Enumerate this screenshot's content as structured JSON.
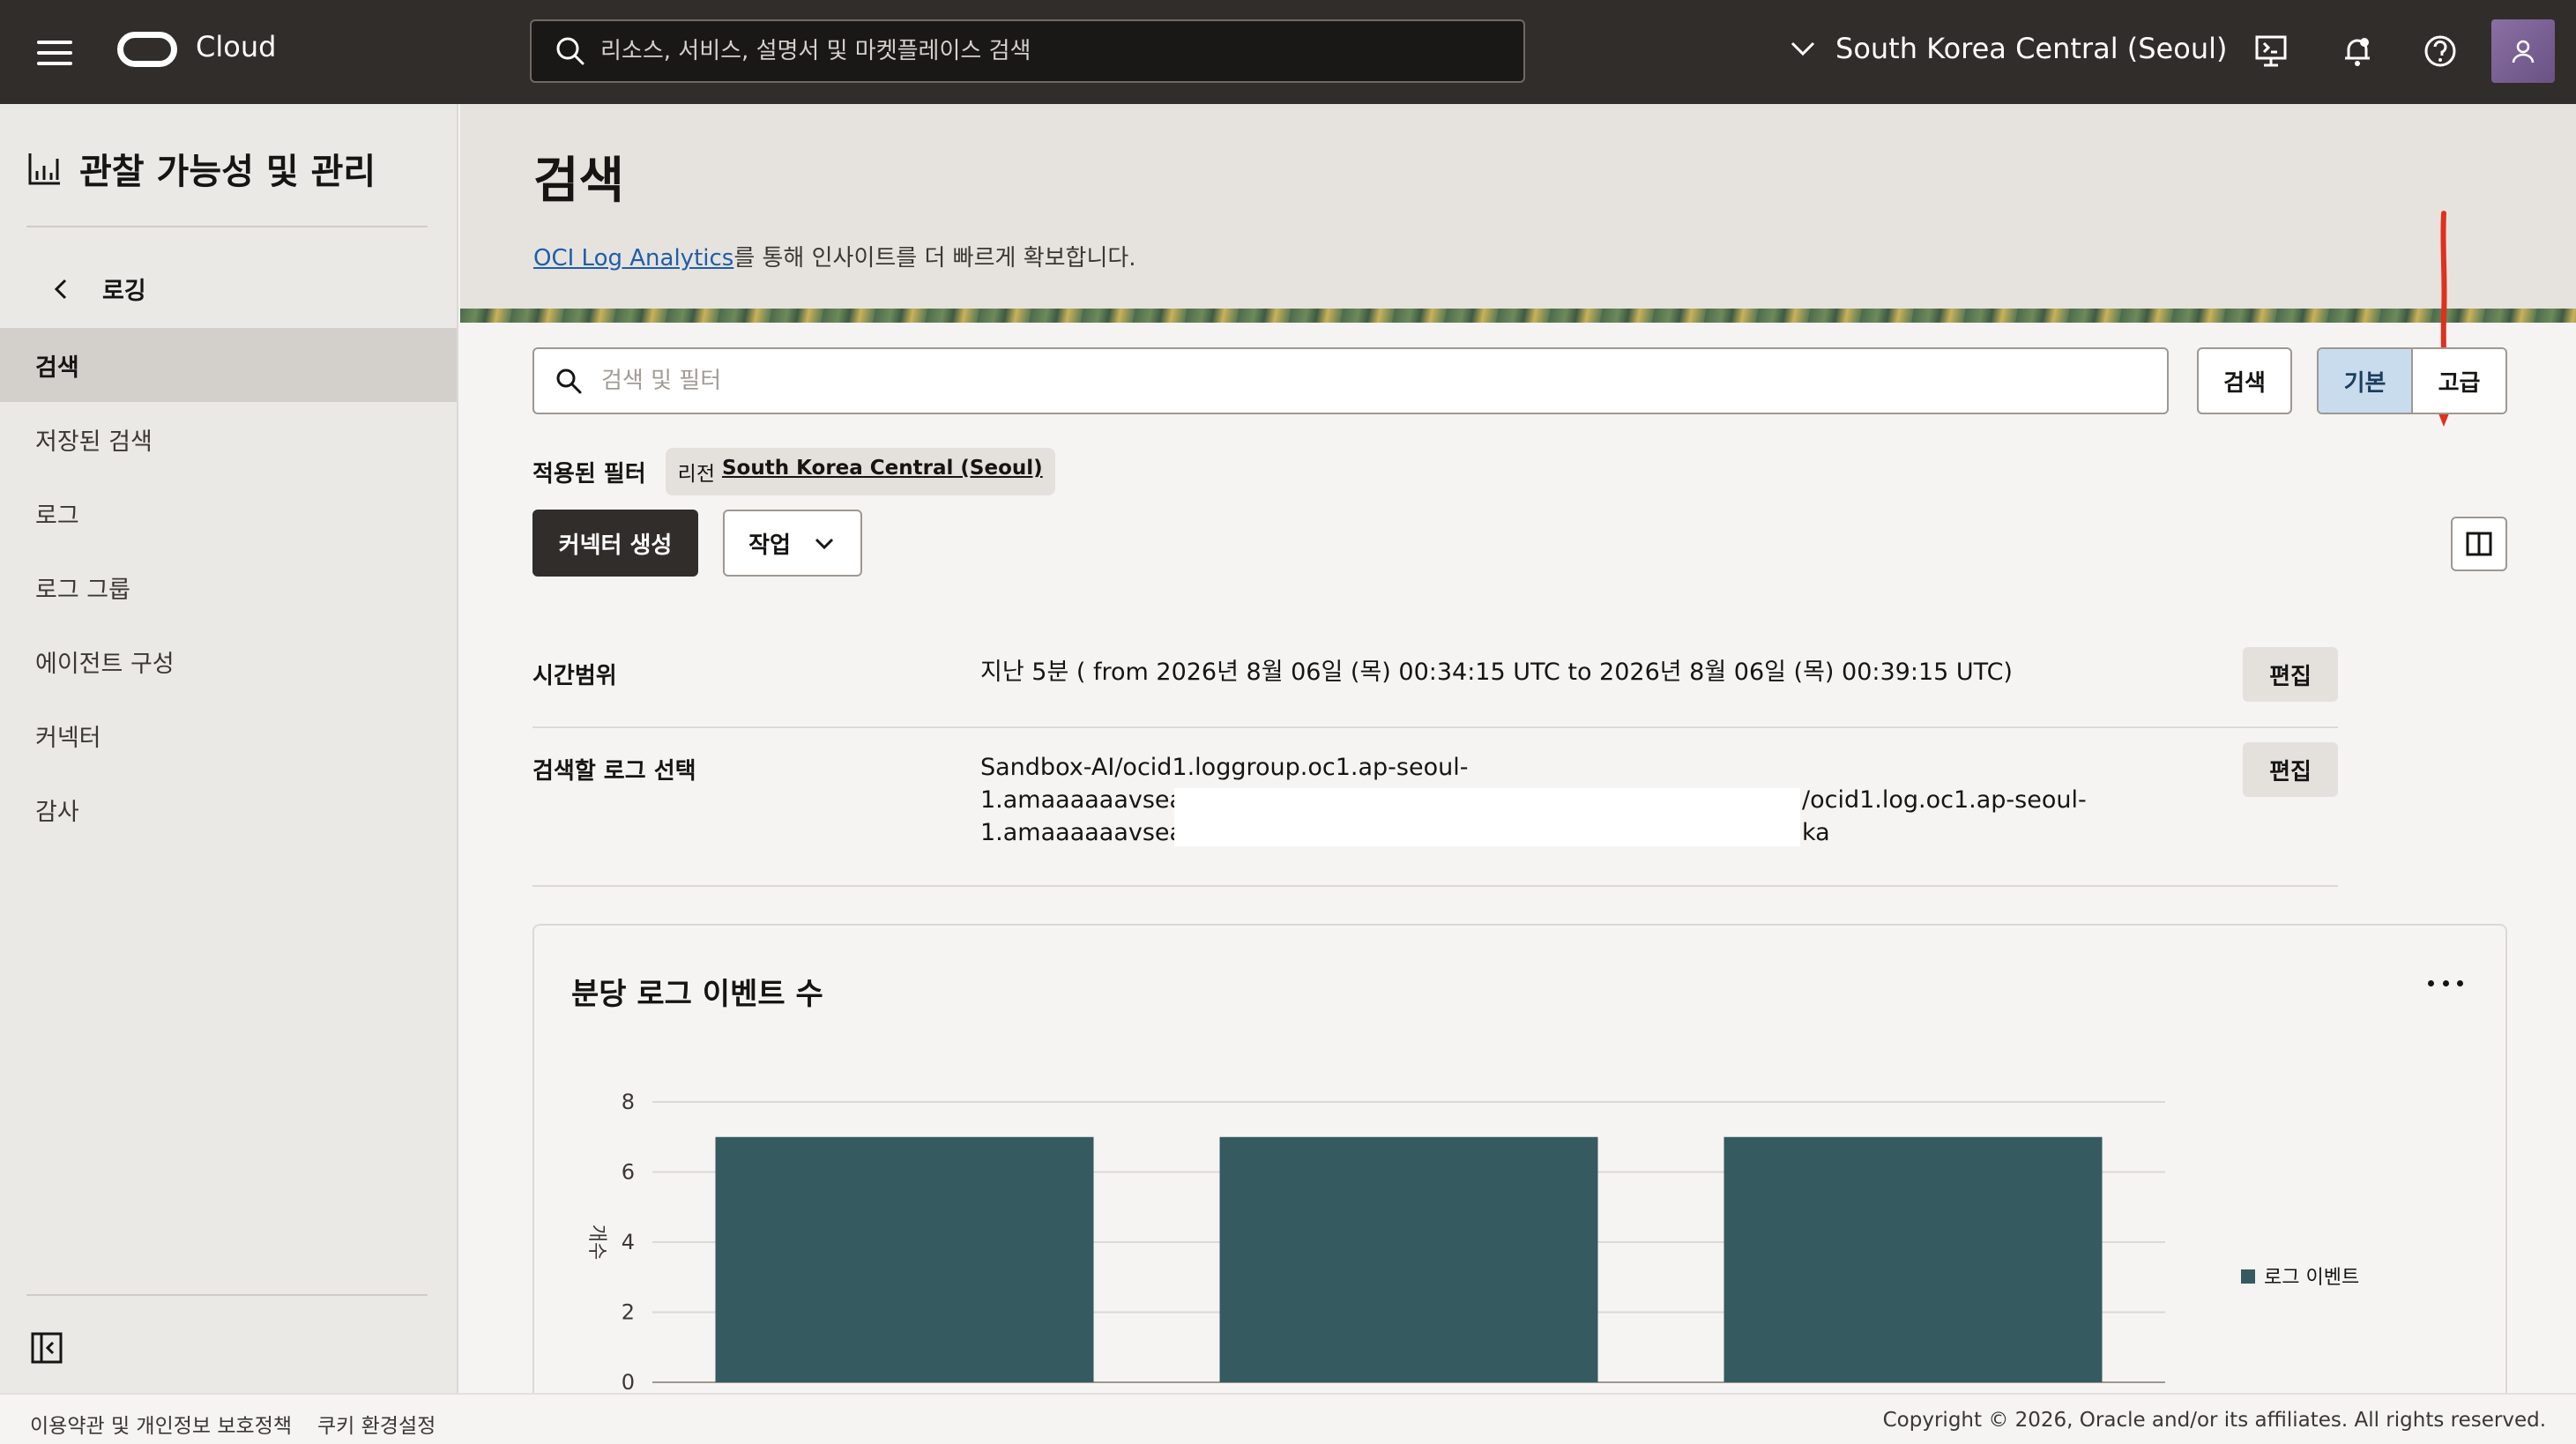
{
  "topbar": {
    "brand": "Cloud",
    "search_placeholder": "리소스, 서비스, 설명서 및 마켓플레이스 검색",
    "region": "South Korea Central (Seoul)",
    "icons": [
      "menu-icon",
      "cloud-shell-icon",
      "bell-icon",
      "help-icon",
      "avatar-icon"
    ]
  },
  "sidebar": {
    "title": "관찰 가능성 및 관리",
    "back_label": "로깅",
    "items": [
      {
        "label": "검색",
        "active": true
      },
      {
        "label": "저장된 검색",
        "active": false
      },
      {
        "label": "로그",
        "active": false
      },
      {
        "label": "로그 그룹",
        "active": false
      },
      {
        "label": "에이전트 구성",
        "active": false
      },
      {
        "label": "커넥터",
        "active": false
      },
      {
        "label": "감사",
        "active": false
      }
    ]
  },
  "hero": {
    "title": "검색",
    "link_text": "OCI Log Analytics",
    "subtitle_rest": "를 통해 인사이트를 더 빠르게 확보합니다."
  },
  "search": {
    "placeholder": "검색 및 필터",
    "search_button": "검색",
    "mode_basic": "기본",
    "mode_advanced": "고급",
    "active_mode": "기본"
  },
  "filters": {
    "label": "적용된 필터",
    "chip_key": "리전",
    "chip_value": "South Korea Central (Seoul)"
  },
  "actions": {
    "create_connector": "커넥터 생성",
    "actions_menu": "작업"
  },
  "time_range": {
    "label": "시간범위",
    "value": "지난 5분 ( from 2026년 8월 06일 (목) 00:34:15 UTC to 2026년 8월 06일 (목) 00:39:15 UTC)",
    "edit": "편집"
  },
  "log_select": {
    "label": "검색할 로그 선택",
    "line1": "Sandbox-AI/ocid1.loggroup.oc1.ap-seoul-",
    "line2_left": "1.amaaaaaavsea7",
    "line2_right": "/ocid1.log.oc1.ap-seoul-",
    "line3_left": "1.amaaaaaavsea7",
    "line3_right": "ka",
    "edit": "편집"
  },
  "chart_card": {
    "title": "분당 로그 이벤트 수"
  },
  "chart_data": {
    "type": "bar",
    "title": "분당 로그 이벤트 수",
    "xlabel": "",
    "ylabel": "개수",
    "ylim": [
      0,
      8
    ],
    "yticks": [
      0,
      2,
      4,
      6,
      8
    ],
    "grid": true,
    "legend": "right",
    "series": [
      {
        "name": "로그 이벤트",
        "values": [
          7,
          7,
          7
        ],
        "color": "#355a60"
      }
    ]
  },
  "footer": {
    "terms": "이용약관 및 개인정보 보호정책",
    "cookies": "쿠키 환경설정",
    "copyright": "Copyright © 2026, Oracle and/or its affiliates. All rights reserved."
  }
}
